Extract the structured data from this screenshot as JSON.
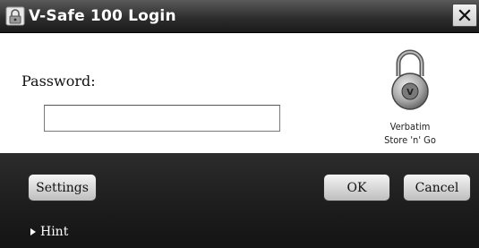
{
  "window": {
    "title": "V-Safe 100 Login",
    "title_icon": "lock-app-icon",
    "close_icon": "close-icon"
  },
  "login": {
    "password_label": "Password:",
    "password_value": "",
    "password_placeholder": ""
  },
  "brand": {
    "logo_icon": "padlock-icon",
    "line1": "Verbatim",
    "line2": "Store 'n' Go"
  },
  "buttons": {
    "settings": "Settings",
    "ok": "OK",
    "cancel": "Cancel"
  },
  "hint": {
    "label": "Hint",
    "expander_icon": "triangle-right-icon"
  },
  "colors": {
    "titlebar": "#2e2e2e",
    "bottom_panel": "#1c1c1c",
    "button_face": "#d9d9d9",
    "text_light": "#ffffff"
  }
}
